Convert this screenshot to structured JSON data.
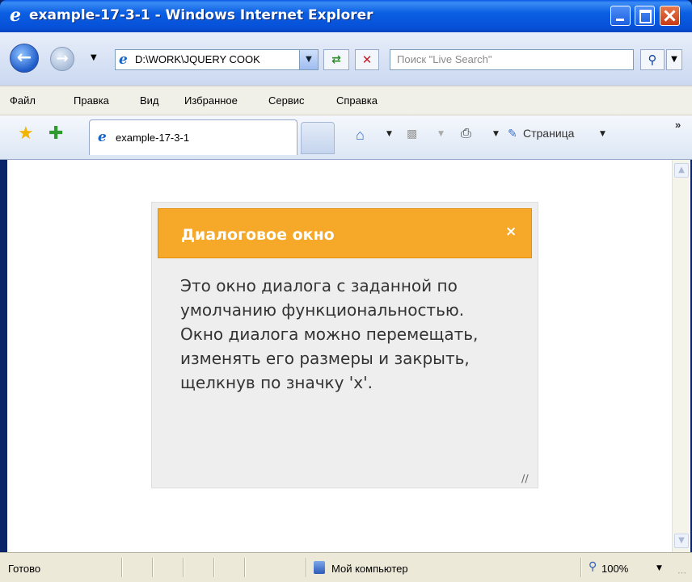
{
  "window": {
    "title": "example-17-3-1 - Windows Internet Explorer"
  },
  "address_bar": {
    "url": "D:\\WORK\\JQUERY COOK",
    "search_placeholder": "Поиск \"Live Search\""
  },
  "menu": {
    "items": [
      "Файл",
      "Правка",
      "Вид",
      "Избранное",
      "Сервис",
      "Справка"
    ]
  },
  "tabs": {
    "active_label": "example-17-3-1"
  },
  "toolbar": {
    "page_label": "Страница",
    "more": "»"
  },
  "dialog": {
    "title": "Диалоговое окно",
    "close_symbol": "×",
    "body": "Это окно диалога с заданной по умолчанию функциональностью. Окно диалога можно перемещать, изменять его размеры и закрыть, щелкнув по значку 'x'."
  },
  "status_bar": {
    "status": "Готово",
    "zone": "Мой компьютер",
    "zoom": "100%"
  },
  "colors": {
    "dialog_header": "#f6a828",
    "titlebar": "#0b5fe3"
  }
}
